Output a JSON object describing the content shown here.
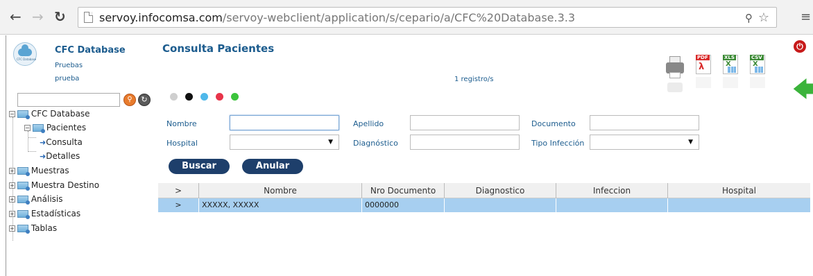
{
  "browser": {
    "url_host": "servoy.infocomsa.com",
    "url_path": "/servoy-webclient/application/s/cepario/a/CFC%20Database.3.3"
  },
  "app": {
    "logo_text": "CFC Database",
    "title": "CFC Database",
    "sub1": "Pruebas",
    "sub2": "prueba"
  },
  "tree": {
    "root": "CFC Database",
    "pacientes": "Pacientes",
    "consulta": "Consulta",
    "detalles": "Detalles",
    "muestras": "Muestras",
    "muestra_destino": "Muestra Destino",
    "analisis": "Análisis",
    "estadisticas": "Estadísticas",
    "tablas": "Tablas"
  },
  "main": {
    "title": "Consulta Pacientes",
    "records": "1 registro/s",
    "dot_colors": [
      "#cfcfcf",
      "#111111",
      "#4fb8ea",
      "#e8344a",
      "#3cc43c"
    ]
  },
  "toolbar": {
    "pdf": "PDF",
    "xls": "XLS",
    "csv": "CSV",
    "colors": {
      "pdf": "#d92b2b",
      "xls": "#3b8a34",
      "csv": "#3b8a34"
    }
  },
  "form": {
    "nombre_label": "Nombre",
    "nombre_value": "",
    "apellido_label": "Apellido",
    "apellido_value": "",
    "documento_label": "Documento",
    "documento_value": "",
    "hospital_label": "Hospital",
    "hospital_value": "",
    "diagnostico_label": "Diagnóstico",
    "diagnostico_value": "",
    "tipo_label": "Tipo Infección",
    "tipo_value": ""
  },
  "buttons": {
    "buscar": "Buscar",
    "anular": "Anular"
  },
  "grid": {
    "headers": [
      ">",
      "Nombre",
      "Nro Documento",
      "Diagnostico",
      "Infeccion",
      "Hospital"
    ],
    "rows": [
      [
        ">",
        "XXXXX, XXXXX",
        "0000000",
        "",
        "",
        ""
      ]
    ]
  }
}
